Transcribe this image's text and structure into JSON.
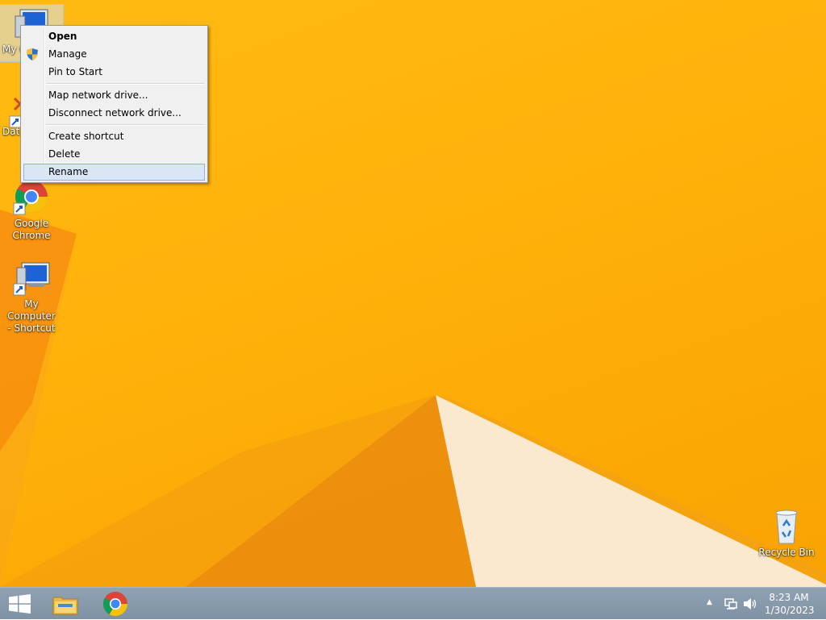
{
  "desktop": {
    "icons": [
      {
        "label": "My Computer",
        "icon": "my-computer-icon",
        "selected": true
      },
      {
        "label": "Data",
        "icon": "data-shortcut-icon"
      },
      {
        "label": "Google Chrome",
        "icon": "chrome-icon"
      },
      {
        "label": "My Computer - Shortcut",
        "icon": "my-computer-icon"
      },
      {
        "label": "Recycle Bin",
        "icon": "recycle-bin-icon"
      }
    ],
    "icon_labels": {
      "my_computer_partial": "My C",
      "data_partial": "Data",
      "chrome_line1": "Google",
      "chrome_line2": "Chrome",
      "mycomp_shortcut_line1": "My Computer",
      "mycomp_shortcut_line2": "- Shortcut",
      "recycle_bin": "Recycle Bin"
    }
  },
  "context_menu": {
    "items": [
      {
        "label": "Open",
        "bold": true
      },
      {
        "label": "Manage",
        "icon": "uac-shield-icon"
      },
      {
        "label": "Pin to Start"
      },
      {
        "label": "Map network drive..."
      },
      {
        "label": "Disconnect network drive..."
      },
      {
        "label": "Create shortcut"
      },
      {
        "label": "Delete"
      },
      {
        "label": "Rename",
        "highlighted": true
      }
    ]
  },
  "taskbar": {
    "pinned": [
      "windows-start-icon",
      "file-explorer-icon",
      "chrome-icon"
    ],
    "tray": {
      "show_hidden_label": "▲",
      "icons": [
        "network-icon",
        "volume-icon"
      ]
    },
    "clock": {
      "time": "8:23 AM",
      "date": "1/30/2023"
    }
  },
  "colors": {
    "wallpaper": "#ffb10a",
    "taskbar": "#8596a7",
    "menu_bg": "#f0f0f0",
    "menu_highlight": "#d9e6f6"
  }
}
